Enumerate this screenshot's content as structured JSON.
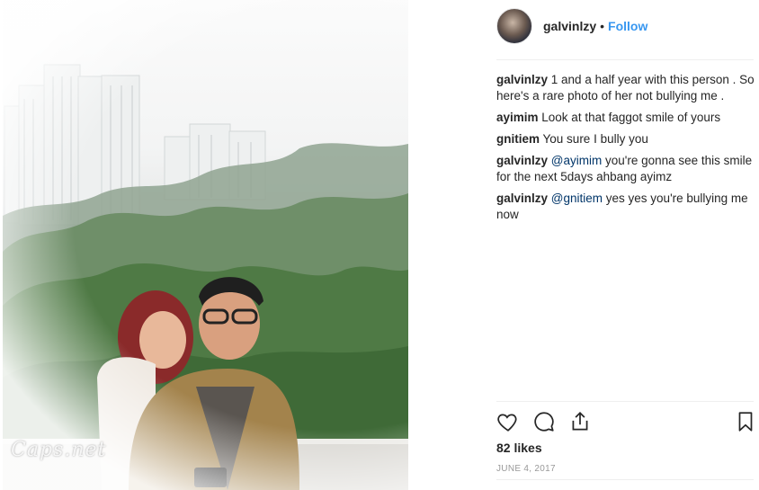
{
  "post": {
    "watermark": "Caps.net",
    "photo_description_colors": {
      "sky": "#f3f4f4",
      "foliage": "#4f7a45",
      "building": "#e9ecec"
    }
  },
  "header": {
    "username": "galvinlzy",
    "separator": "•",
    "follow_label": "Follow"
  },
  "comments": [
    {
      "author": "galvinlzy",
      "text": " 1 and a half year with this person . So here's a rare photo of her not bullying me ."
    },
    {
      "author": "ayimim",
      "text": " Look at that faggot smile of yours"
    },
    {
      "author": "gnitiem",
      "text": " You sure I bully you"
    },
    {
      "author": "galvinlzy",
      "mention": "@ayimim",
      "text": " you're gonna see this smile for the next 5days ahbang ayimz"
    },
    {
      "author": "galvinlzy",
      "mention": "@gnitiem",
      "text": " yes yes you're bullying me now"
    }
  ],
  "actions": {
    "like_icon": "heart-icon",
    "comment_icon": "comment-bubble-icon",
    "share_icon": "share-icon",
    "save_icon": "bookmark-icon"
  },
  "likes": "82 likes",
  "date": "JUNE 4, 2017",
  "colors": {
    "link": "#3897f0",
    "mention": "#003569",
    "meta": "#999999",
    "text": "#262626"
  }
}
